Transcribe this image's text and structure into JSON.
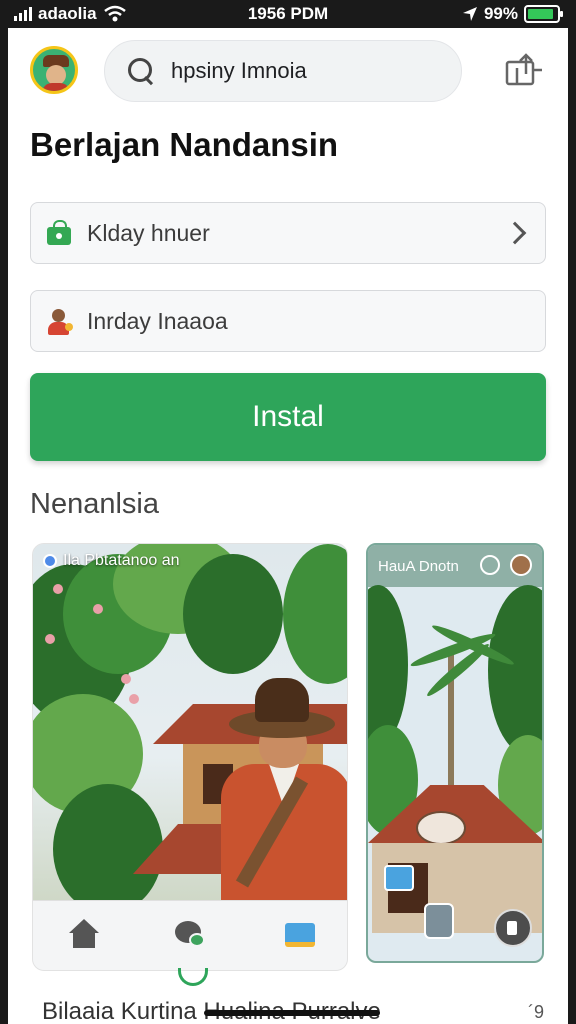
{
  "status_bar": {
    "carrier": "adaolia",
    "time": "1956 PDM",
    "battery_percent": "99%",
    "battery_level": 0.9
  },
  "search": {
    "value": "hpsiny Imnoia"
  },
  "page_title": "Berlajan Nandansin",
  "fields": {
    "field_1": {
      "text": "Klday hnuer",
      "icon": "shopping-bag-icon"
    },
    "field_2": {
      "text": "Inrday Inaaoa",
      "icon": "person-icon"
    }
  },
  "install_button": {
    "label": "Instal",
    "color": "#2ea55a"
  },
  "section_title": "Nenanlsia",
  "card_main": {
    "caption": "Ila Pbtatanoo an",
    "nav": [
      "home-icon",
      "chat-icon",
      "message-icon"
    ]
  },
  "card_side": {
    "title": "HauA Dnotn"
  },
  "bottom": {
    "text": "Bilaaia Kurtina Hualina Purralve",
    "right_label": "´9"
  }
}
